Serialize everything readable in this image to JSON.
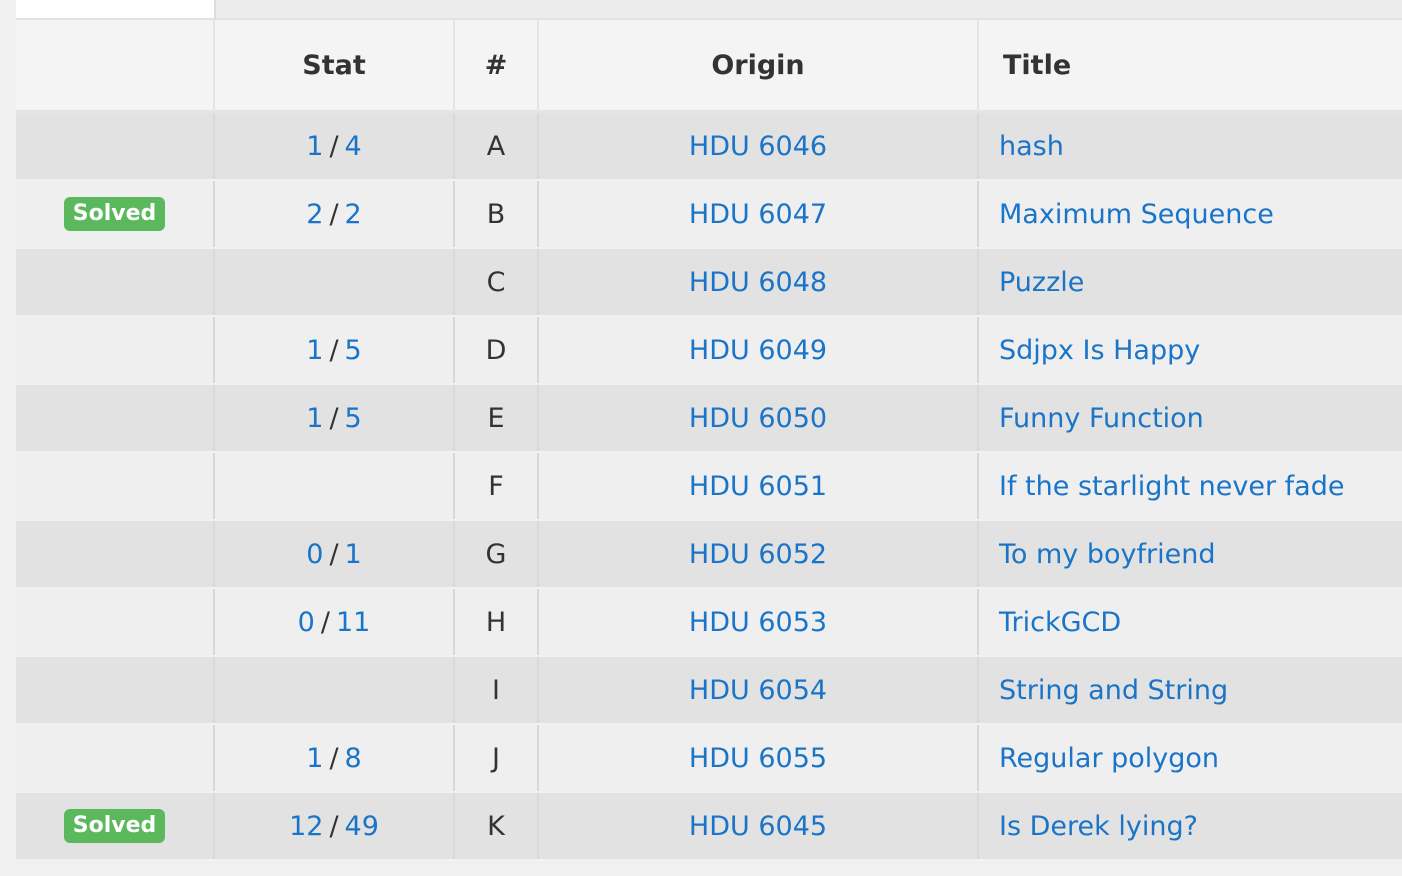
{
  "table": {
    "headers": {
      "status": "",
      "stat": "Stat",
      "num": "#",
      "origin": "Origin",
      "title": "Title"
    },
    "rows": [
      {
        "status": "",
        "solved": "",
        "total": "4",
        "accepted": "1",
        "num": "A",
        "origin": "HDU 6046",
        "title": "hash"
      },
      {
        "status": "Solved",
        "accepted": "2",
        "total": "2",
        "num": "B",
        "origin": "HDU 6047",
        "title": "Maximum Sequence"
      },
      {
        "status": "",
        "accepted": "",
        "total": "",
        "num": "C",
        "origin": "HDU 6048",
        "title": "Puzzle"
      },
      {
        "status": "",
        "accepted": "1",
        "total": "5",
        "num": "D",
        "origin": "HDU 6049",
        "title": "Sdjpx Is Happy"
      },
      {
        "status": "",
        "accepted": "1",
        "total": "5",
        "num": "E",
        "origin": "HDU 6050",
        "title": "Funny Function"
      },
      {
        "status": "",
        "accepted": "",
        "total": "",
        "num": "F",
        "origin": "HDU 6051",
        "title": "If the starlight never fade"
      },
      {
        "status": "",
        "accepted": "0",
        "total": "1",
        "num": "G",
        "origin": "HDU 6052",
        "title": "To my boyfriend"
      },
      {
        "status": "",
        "accepted": "0",
        "total": "11",
        "num": "H",
        "origin": "HDU 6053",
        "title": "TrickGCD"
      },
      {
        "status": "",
        "accepted": "",
        "total": "",
        "num": "I",
        "origin": "HDU 6054",
        "title": "String and String"
      },
      {
        "status": "",
        "accepted": "1",
        "total": "8",
        "num": "J",
        "origin": "HDU 6055",
        "title": "Regular polygon"
      },
      {
        "status": "Solved",
        "accepted": "12",
        "total": "49",
        "num": "K",
        "origin": "HDU 6045",
        "title": "Is Derek lying?"
      }
    ]
  },
  "colors": {
    "link": "#1a74c8",
    "solved_badge": "#5cb85c",
    "header_text": "#333333"
  }
}
